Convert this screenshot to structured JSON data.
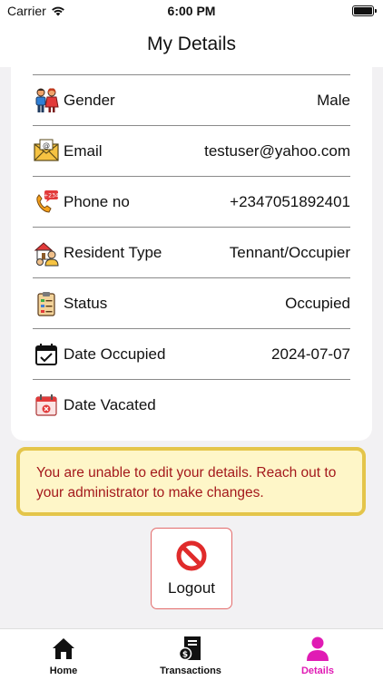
{
  "status_bar": {
    "carrier": "Carrier",
    "time": "6:00 PM"
  },
  "header": {
    "title": "My Details"
  },
  "details": [
    {
      "label": "Gender",
      "value": "Male",
      "icon": "gender-icon"
    },
    {
      "label": "Email",
      "value": "testuser@yahoo.com",
      "icon": "email-icon"
    },
    {
      "label": "Phone no",
      "value": "+2347051892401",
      "icon": "phone-icon"
    },
    {
      "label": "Resident Type",
      "value": "Tennant/Occupier",
      "icon": "resident-icon"
    },
    {
      "label": "Status",
      "value": "Occupied",
      "icon": "clipboard-icon"
    },
    {
      "label": "Date Occupied",
      "value": "2024-07-07",
      "icon": "calendar-check-icon"
    },
    {
      "label": "Date Vacated",
      "value": "",
      "icon": "calendar-vacated-icon"
    }
  ],
  "notice": {
    "text": "You are unable to edit your details. Reach out to your administrator to make changes."
  },
  "logout": {
    "label": "Logout"
  },
  "tabs": [
    {
      "label": "Home",
      "icon": "home-icon",
      "active": false
    },
    {
      "label": "Transactions",
      "icon": "transactions-icon",
      "active": false
    },
    {
      "label": "Details",
      "icon": "person-icon",
      "active": true
    }
  ],
  "colors": {
    "accent": "#e01bb4",
    "notice_text": "#a4191c",
    "notice_bg": "#fef6c8",
    "notice_border": "#e4c54a",
    "logout_icon": "#e02b2b"
  }
}
